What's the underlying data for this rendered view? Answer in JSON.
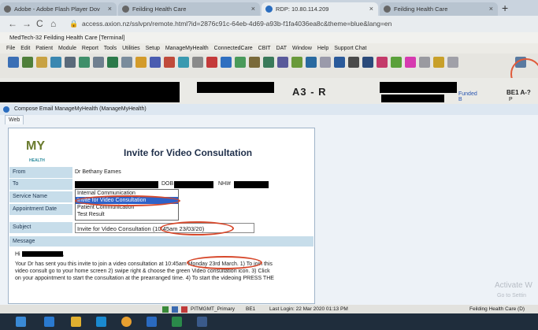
{
  "browser": {
    "tabs": [
      {
        "label": "Adobe - Adobe Flash Player Dov",
        "close": "×"
      },
      {
        "label": "Feilding Health Care",
        "close": "×"
      },
      {
        "label": "RDP: 10.80.114.209",
        "close": "×"
      },
      {
        "label": "Feilding Health Care",
        "close": "×"
      }
    ],
    "new_tab": "+",
    "url": "access.axion.nz/sslvpn/remote.html?id=2876c91c-64eb-4d69-a93b-f1fa4036ea8c&theme=blue&lang=en"
  },
  "app": {
    "title": "MedTech-32 Feilding Health Care [Terminal]",
    "menu": [
      "File",
      "Edit",
      "Patient",
      "Module",
      "Report",
      "Tools",
      "Utilities",
      "Setup",
      "ManageMyHealth",
      "ConnectedCare",
      "CBIT",
      "DAT",
      "Window",
      "Help",
      "Support Chat"
    ],
    "banner": {
      "code": "A3 - R",
      "funded": "Funded",
      "funded_sub": "B",
      "provider": "BE1 A-?",
      "provider_sub": "P"
    }
  },
  "compose": {
    "window_title": "Compose Email ManageMyHealth (ManageMyHealth)",
    "tab": "Web",
    "logo_text": "MY",
    "logo_sub": "HEALTH",
    "heading": "Invite for Video Consultation",
    "from_label": "From",
    "from_value": "Dr Bethany Eames",
    "to_label": "To",
    "dob_label": "DOB",
    "nhi_label": "NHI#",
    "service_label": "Service Name",
    "service_options": [
      "Internal Communication",
      "Invite for Video Consultation",
      "Patient Communication",
      "Test Result"
    ],
    "appointment_label": "Appointment Date",
    "subject_label": "Subject",
    "subject_value": "Invite for Video Consultation (10:45am 23/03/20)",
    "message_label": "Message",
    "greeting": "Hi",
    "greeting_end": ",",
    "body_1": "Your Dr has sent you this invite to join a video consultation at 10:45am Monday 23rd March. 1) To join this",
    "body_2": "video consult go to your home screen 2) swipe right & choose the green Video consultation icon. 3) Click",
    "body_3": "on your appointment to start the consultation at the prearranged time. 4) To start the videoing PRESS THE"
  },
  "watermark": {
    "line1": "Activate W",
    "line2": "Go to Settin"
  },
  "status": {
    "queue": "PITMGMT_Primary",
    "code": "BE1",
    "last_login": "Last Login: 22 Mar 2020 01:13 PM",
    "org": "Feilding Health Care (D)"
  },
  "colors": {
    "accent": "#2f62c8",
    "circle": "#d7492c"
  }
}
